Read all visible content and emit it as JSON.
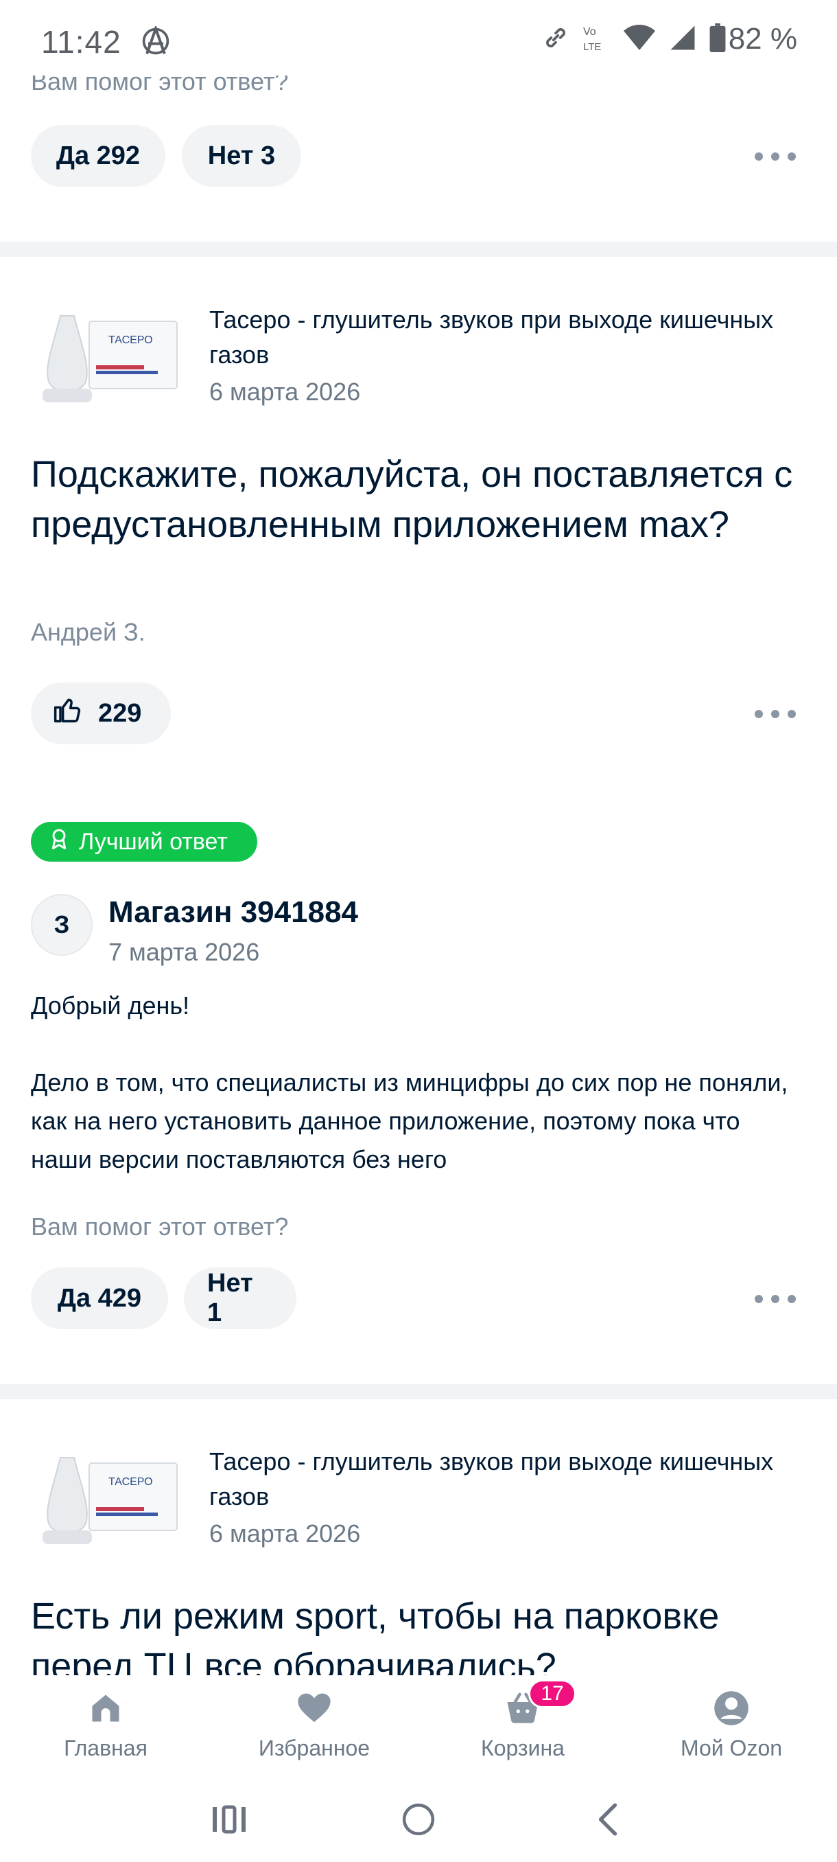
{
  "status_bar": {
    "time": "11:42",
    "battery": "82 %",
    "icons": [
      "anarchy-icon",
      "link-icon",
      "volte-icon",
      "wifi-icon",
      "signal-icon",
      "battery-icon"
    ],
    "volte_top": "Vo",
    "volte_bottom": "LTE"
  },
  "clipped_top": {
    "helped_text": "Вам помог этот ответ?",
    "yes_button": "Да 292",
    "no_button": "Нет 3"
  },
  "question_1": {
    "product_title": "Тасеро - глушитель звуков при выходе кишечных газов",
    "product_date": "6 марта 2026",
    "question": "Подскажите, пожалуйста, он поставляется с предустановленным приложением max?",
    "author": "Андрей З.",
    "likes": "229",
    "best_answer_badge": "Лучший ответ",
    "answer": {
      "avatar_letter": "З",
      "shop_name": "Магазин 3941884",
      "date": "7 марта 2026",
      "greeting": "Добрый день!",
      "body": "Дело в том, что специалисты из минцифры до сих пор не поняли, как на него установить данное приложение, поэтому пока что наши версии поставляются без него",
      "helped_text": "Вам помог этот ответ?",
      "yes_button": "Да 429",
      "no_button": "Нет 1"
    }
  },
  "question_2": {
    "product_title": "Тасеро - глушитель звуков при выходе кишечных газов",
    "product_date": "6 марта 2026",
    "question": "Есть ли режим sport, чтобы на парковке перед ТЦ все оборачивались?"
  },
  "product_box_label": "ТАСЕРО",
  "bottom_nav": {
    "items": [
      {
        "label": "Главная",
        "icon": "home-icon"
      },
      {
        "label": "Избранное",
        "icon": "heart-icon"
      },
      {
        "label": "Корзина",
        "icon": "cart-icon"
      },
      {
        "label": "Мой Ozon",
        "icon": "profile-icon"
      }
    ],
    "cart_count": "17"
  },
  "colors": {
    "accent_green": "#10c44c",
    "badge_pink": "#f1117e",
    "text_primary": "#001a34",
    "text_secondary": "#7c8a99",
    "pill_bg": "#f2f3f5"
  }
}
